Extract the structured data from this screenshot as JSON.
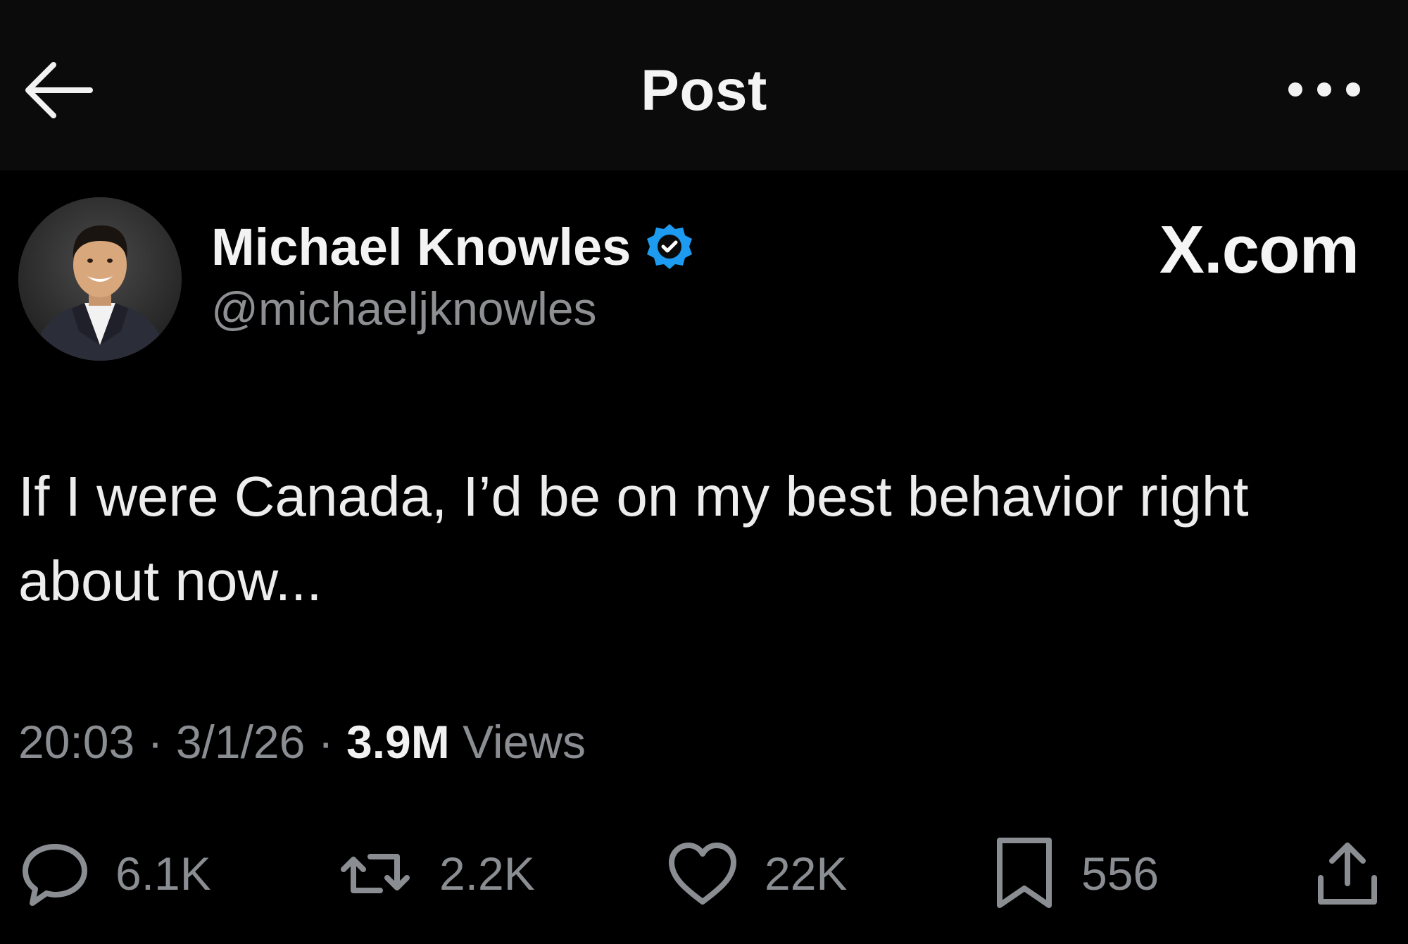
{
  "header": {
    "title": "Post",
    "back_icon": "arrow-left-icon",
    "more_icon": "more-horizontal-icon"
  },
  "author": {
    "display_name": "Michael Knowles",
    "handle": "@michaeljknowles",
    "verified": true,
    "verified_color": "#1d9bf0"
  },
  "watermark": "X.com",
  "post": {
    "text": "If I were Canada, I’d be on my best behavior right about now..."
  },
  "meta": {
    "time": "20:03",
    "separator": "·",
    "date": "3/1/26",
    "views_count": "3.9M",
    "views_label": "Views"
  },
  "actions": {
    "replies": {
      "icon": "reply-icon",
      "count": "6.1K"
    },
    "reposts": {
      "icon": "repost-icon",
      "count": "2.2K"
    },
    "likes": {
      "icon": "heart-icon",
      "count": "22K"
    },
    "bookmarks": {
      "icon": "bookmark-icon",
      "count": "556"
    },
    "share": {
      "icon": "share-icon"
    }
  },
  "colors": {
    "background": "#000000",
    "header_background": "#0b0b0b",
    "text_primary": "#e7e9ea",
    "text_secondary": "#8a8d91",
    "accent": "#1d9bf0"
  }
}
